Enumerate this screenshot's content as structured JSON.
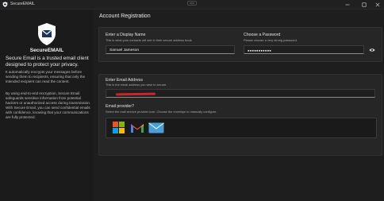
{
  "window": {
    "title": "SecureEMAIL",
    "icons": [
      "app-shield-icon",
      "drag-handle-icon",
      "minimize-icon",
      "maximize-icon",
      "close-icon"
    ]
  },
  "sidebar": {
    "logo_icon": "shield-envelope-icon",
    "brand": "SecureEMAIL",
    "tagline": "Secure Email is a trusted email client designed to protect your privacy.",
    "paragraph1": "It automatically encrypts your messages before sending them to recipients, ensuring that only the intended recipient can read the content.",
    "paragraph2": "By using end-to-end encryption, Secure Email safeguards sensitive information from potential hackers or unauthorized access during transmission. With Secure Email, you can send confidential emails with confidence, knowing that your communications are fully protected."
  },
  "main": {
    "heading": "Account Registration",
    "display_name": {
      "label": "Enter a Display Name",
      "hint": "This is what your contacts will see in their secure address book.",
      "value": "Samuel Jameson"
    },
    "password": {
      "label": "Choose a Password",
      "hint": "Please choose a very strong password.",
      "value": "●●●●●●●●●●●",
      "reveal_icon": "eye-icon"
    },
    "email": {
      "label": "Enter Email Address",
      "hint": "This is the email address you wish to secure."
    },
    "provider": {
      "label": "Email provider?",
      "hint": "Select the mail service provider icon. Choose the envelope to manually configure.",
      "options": [
        "microsoft-icon",
        "gmail-icon",
        "envelope-icon"
      ]
    }
  },
  "colors": {
    "window_bg": "#1e1e1e",
    "sidebar_bg": "#1b1b1b",
    "card_bg": "#262626",
    "redaction": "#d4202a",
    "accent_blue": "#4a9fd8"
  }
}
